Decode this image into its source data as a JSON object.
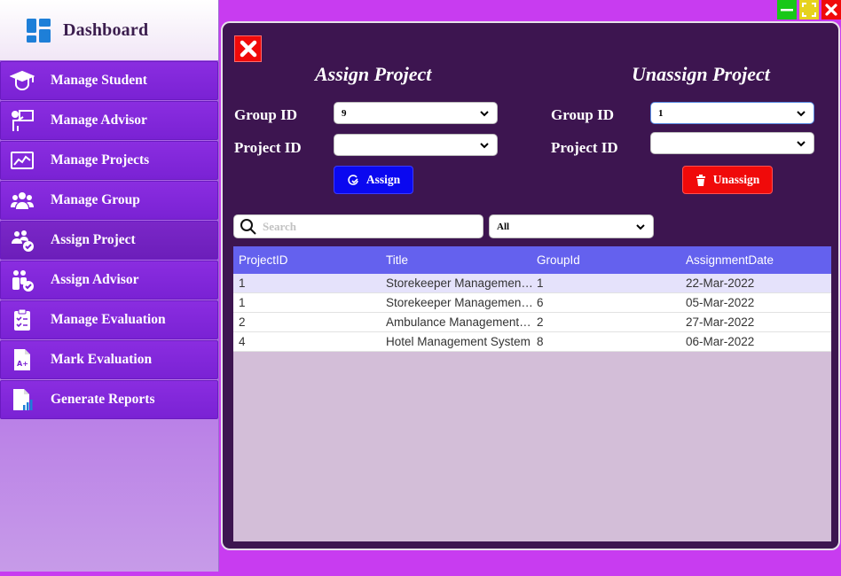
{
  "sidebar": {
    "title": "Dashboard",
    "items": [
      {
        "label": "Manage Student",
        "icon": "graduate-student-icon"
      },
      {
        "label": "Manage Advisor",
        "icon": "teacher-board-icon"
      },
      {
        "label": "Manage Projects",
        "icon": "project-chart-icon"
      },
      {
        "label": "Manage Group",
        "icon": "group-people-icon"
      },
      {
        "label": "Assign Project",
        "icon": "assign-group-check-icon"
      },
      {
        "label": "Assign Advisor",
        "icon": "assign-advisor-check-icon"
      },
      {
        "label": "Manage Evaluation",
        "icon": "clipboard-checklist-icon"
      },
      {
        "label": "Mark Evaluation",
        "icon": "grade-document-icon"
      },
      {
        "label": "Generate Reports",
        "icon": "report-document-chart-icon"
      }
    ]
  },
  "assign": {
    "title": "Assign Project",
    "group_label": "Group ID",
    "group_value": "9",
    "project_label": "Project ID",
    "project_value": "",
    "button_label": "Assign"
  },
  "unassign": {
    "title": "Unassign Project",
    "group_label": "Group ID",
    "group_value": "1",
    "project_label": "Project ID",
    "project_value": "",
    "button_label": "Unassign"
  },
  "search": {
    "placeholder": "Search",
    "filter_value": "All"
  },
  "grid": {
    "columns": [
      "ProjectID",
      "Title",
      "GroupId",
      "AssignmentDate"
    ],
    "rows": [
      [
        "1",
        "Storekeeper Management System",
        "1",
        "22-Mar-2022"
      ],
      [
        "1",
        "Storekeeper Management System",
        "6",
        "05-Mar-2022"
      ],
      [
        "2",
        "Ambulance Management System",
        "2",
        "27-Mar-2022"
      ],
      [
        "4",
        "Hotel Management System",
        "8",
        "06-Mar-2022"
      ]
    ]
  },
  "colors": {
    "accent": "#7a22d4",
    "panel": "#3d1550",
    "assign_button": "#0a08f0",
    "unassign_button": "#f00a0a",
    "grid_header": "#6461ee"
  }
}
